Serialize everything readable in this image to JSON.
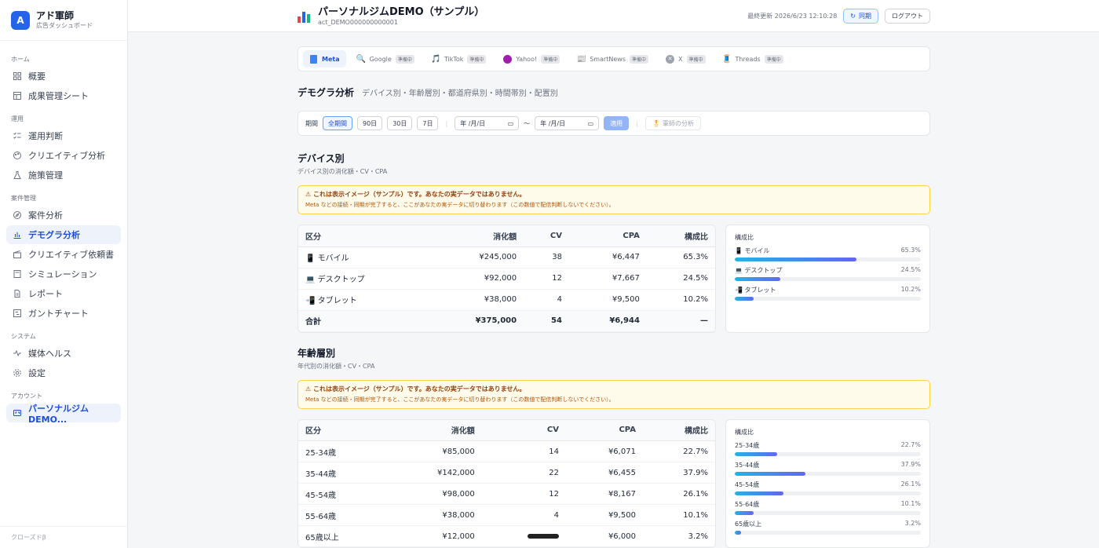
{
  "brand": {
    "logo": "A",
    "name": "アド軍師",
    "sub": "広告ダッシュボード"
  },
  "nav": {
    "sections": [
      {
        "label": "ホーム",
        "items": [
          {
            "label": "概要",
            "icon": "grid-icon"
          },
          {
            "label": "成果管理シート",
            "icon": "table-icon"
          }
        ]
      },
      {
        "label": "運用",
        "items": [
          {
            "label": "運用判断",
            "icon": "checklist-icon"
          },
          {
            "label": "クリエイティブ分析",
            "icon": "palette-icon"
          },
          {
            "label": "施策管理",
            "icon": "flask-icon"
          }
        ]
      },
      {
        "label": "案件管理",
        "items": [
          {
            "label": "案件分析",
            "icon": "compass-icon"
          },
          {
            "label": "デモグラ分析",
            "icon": "bar-chart-icon",
            "active": true
          },
          {
            "label": "クリエイティブ依頼書",
            "icon": "clapper-icon"
          },
          {
            "label": "シミュレーション",
            "icon": "calculator-icon"
          },
          {
            "label": "レポート",
            "icon": "file-icon"
          },
          {
            "label": "ガントチャート",
            "icon": "gantt-icon"
          }
        ]
      },
      {
        "label": "システム",
        "items": [
          {
            "label": "媒体ヘルス",
            "icon": "pulse-icon"
          },
          {
            "label": "設定",
            "icon": "gear-icon"
          }
        ]
      },
      {
        "label": "アカウント",
        "items": [
          {
            "label": "パーソナルジムDEMO...",
            "icon": "account-icon",
            "active": true
          }
        ]
      }
    ],
    "footer": "クローズドβ"
  },
  "header": {
    "title": "パーソナルジムDEMO（サンプル）",
    "account_id": "act_DEMO000000000001",
    "last_update": "最終更新 2026/6/23 12:10:28",
    "sync_label": "同期",
    "logout_label": "ログアウト"
  },
  "media_tabs": [
    {
      "label": "Meta",
      "icon": "meta-book-icon",
      "active": true,
      "badge": ""
    },
    {
      "label": "Google",
      "icon": "magnifier-icon",
      "badge": "準備中"
    },
    {
      "label": "TikTok",
      "icon": "music-note-icon",
      "badge": "準備中"
    },
    {
      "label": "Yahoo!",
      "icon": "purple-circle-icon",
      "badge": "準備中"
    },
    {
      "label": "SmartNews",
      "icon": "newspaper-icon",
      "badge": "準備中"
    },
    {
      "label": "X",
      "icon": "x-circle-icon",
      "badge": "準備中"
    },
    {
      "label": "Threads",
      "icon": "spool-icon",
      "badge": "準備中"
    }
  ],
  "page": {
    "title": "デモグラ分析",
    "desc": "デバイス別・年齢層別・都道府県別・時間帯別・配置別"
  },
  "filter": {
    "period_label": "期間",
    "presets": [
      {
        "label": "全期間",
        "active": true
      },
      {
        "label": "90日"
      },
      {
        "label": "30日"
      },
      {
        "label": "7日"
      }
    ],
    "date_from": "年 /月/日",
    "date_to": "年 /月/日",
    "tilde": "〜",
    "apply_label": "適用",
    "analyze_label": "軍師の分析"
  },
  "warning": {
    "title": "⚠ これは表示イメージ（サンプル）です。あなたの実データではありません。",
    "sub": "Meta などの接続・同期が完了すると、ここがあなたの実データに切り替わります（この数値で配信判断しないでください）。"
  },
  "device": {
    "title": "デバイス別",
    "sub": "デバイス別の消化額・CV・CPA",
    "headers": [
      "区分",
      "消化額",
      "CV",
      "CPA",
      "構成比"
    ],
    "rows": [
      [
        "📱 モバイル",
        "¥245,000",
        "38",
        "¥6,447",
        "65.3%"
      ],
      [
        "💻 デスクトップ",
        "¥92,000",
        "12",
        "¥7,667",
        "24.5%"
      ],
      [
        "📲 タブレット",
        "¥38,000",
        "4",
        "¥9,500",
        "10.2%"
      ]
    ],
    "total": [
      "合計",
      "¥375,000",
      "54",
      "¥6,944",
      "—"
    ],
    "composition_title": "構成比",
    "composition": [
      {
        "label": "📱 モバイル",
        "pct": "65.3%",
        "value": 65.3
      },
      {
        "label": "💻 デスクトップ",
        "pct": "24.5%",
        "value": 24.5
      },
      {
        "label": "📲 タブレット",
        "pct": "10.2%",
        "value": 10.2
      }
    ]
  },
  "age": {
    "title": "年齢層別",
    "sub": "年代別の消化額・CV・CPA",
    "headers": [
      "区分",
      "消化額",
      "CV",
      "CPA",
      "構成比"
    ],
    "rows": [
      [
        "25-34歳",
        "¥85,000",
        "14",
        "¥6,071",
        "22.7%"
      ],
      [
        "35-44歳",
        "¥142,000",
        "22",
        "¥6,455",
        "37.9%"
      ],
      [
        "45-54歳",
        "¥98,000",
        "12",
        "¥8,167",
        "26.1%"
      ],
      [
        "55-64歳",
        "¥38,000",
        "4",
        "¥9,500",
        "10.1%"
      ],
      [
        "65歳以上",
        "¥12,000",
        "",
        "¥6,000",
        "3.2%"
      ]
    ],
    "composition_title": "構成比",
    "composition": [
      {
        "label": "25-34歳",
        "pct": "22.7%",
        "value": 22.7
      },
      {
        "label": "35-44歳",
        "pct": "37.9%",
        "value": 37.9
      },
      {
        "label": "45-54歳",
        "pct": "26.1%",
        "value": 26.1
      },
      {
        "label": "55-64歳",
        "pct": "10.1%",
        "value": 10.1
      },
      {
        "label": "65歳以上",
        "pct": "3.2%",
        "value": 3.2
      }
    ]
  }
}
